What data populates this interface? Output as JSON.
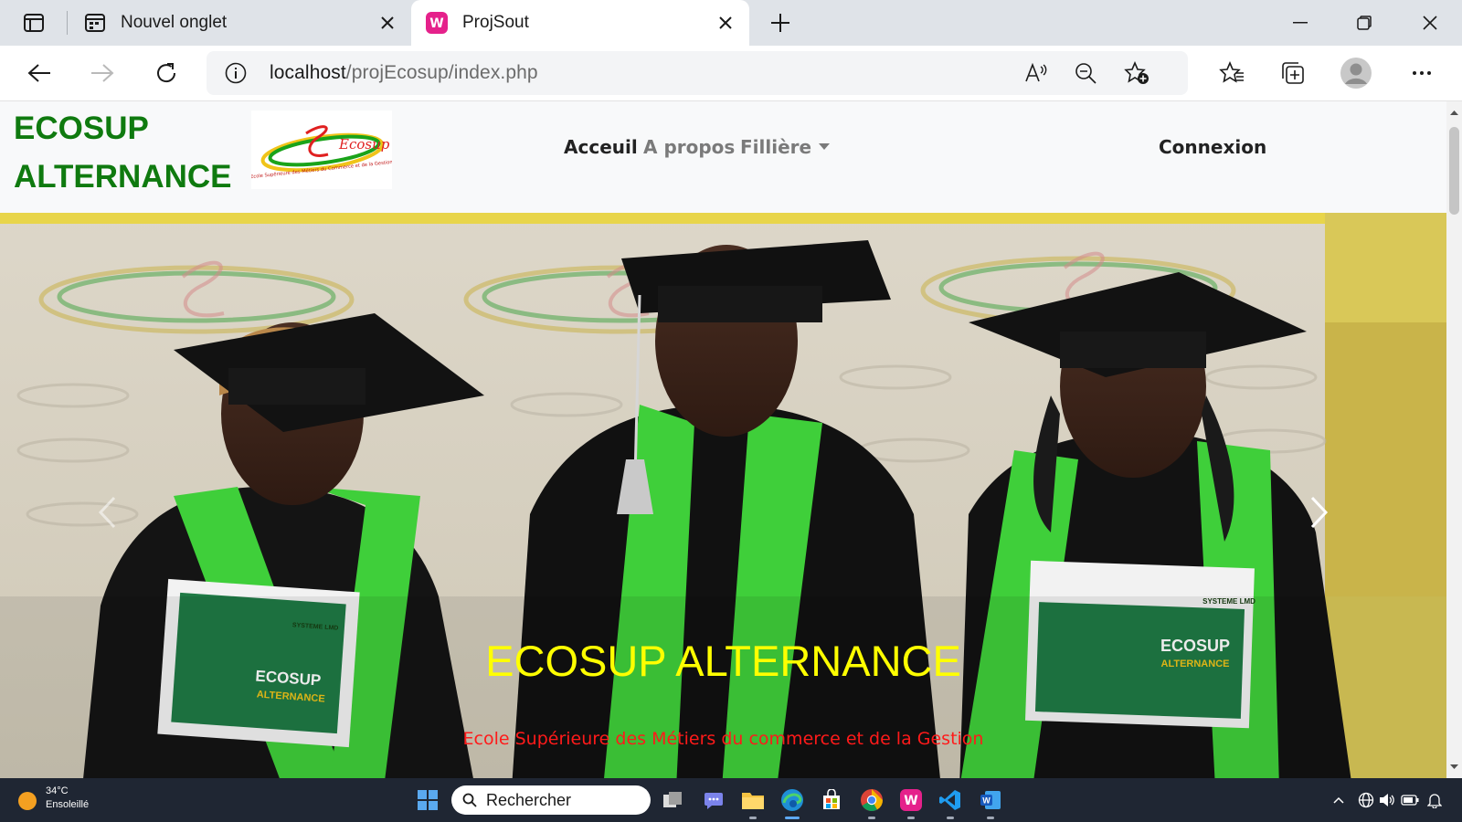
{
  "browser": {
    "tabs": [
      {
        "title": "Nouvel onglet",
        "icon": "new-tab-page-icon",
        "active": false
      },
      {
        "title": "ProjSout",
        "icon": "wampserver-icon",
        "active": true
      }
    ],
    "address": {
      "host": "localhost",
      "path": "/projEcosup/index.php"
    },
    "toolbar_icons": [
      "back-icon",
      "forward-icon",
      "refresh-icon",
      "info-icon",
      "read-aloud-icon",
      "zoom-out-icon",
      "add-favorite-icon",
      "favorites-icon",
      "collections-icon",
      "profile-avatar",
      "more-icon"
    ]
  },
  "site": {
    "brand_line1": "ECOSUP",
    "brand_line2": "ALTERNANCE",
    "logo_text": "Ecosup",
    "logo_caption": "Ecole Supérieure des Métiers du Commerce et de la Gestion",
    "nav": {
      "acceuil": "Acceuil",
      "apropos": "A propos",
      "filliere": "Fillière",
      "connexion": "Connexion"
    },
    "hero": {
      "title": "ECOSUP ALTERNANCE",
      "subtitle": "Ecole Supérieure des Métiers du commerce et de la Gestion",
      "brochure_heading": "ECOSUP",
      "brochure_sub": "ALTERNANCE",
      "brochure_band": "SYSTEME LMD"
    }
  },
  "taskbar": {
    "weather_temp": "34°C",
    "weather_desc": "Ensoleillé",
    "search_placeholder": "Rechercher"
  },
  "colors": {
    "brand_green": "#0f7a0f",
    "hero_title": "#ffff00",
    "hero_subtitle": "#ff1a1a",
    "stole_green": "#3fcf3a"
  }
}
